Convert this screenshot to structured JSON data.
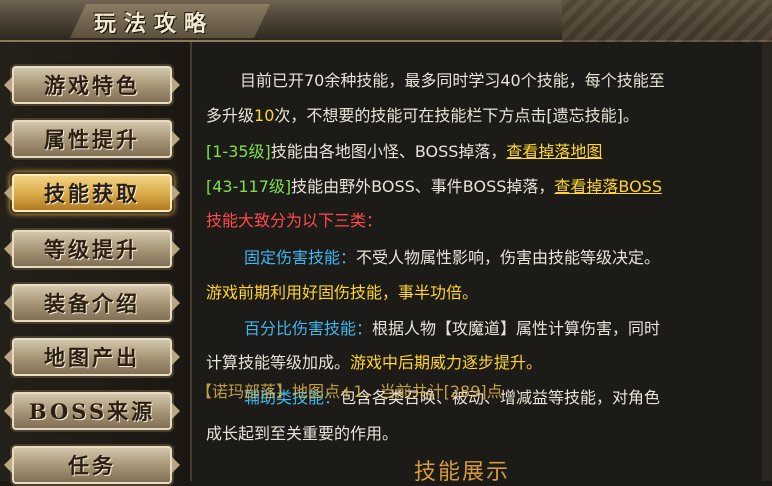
{
  "window": {
    "title": "玩法攻略"
  },
  "sidebar": {
    "items": [
      {
        "label": "游戏特色",
        "active": false
      },
      {
        "label": "属性提升",
        "active": false
      },
      {
        "label": "技能获取",
        "active": true
      },
      {
        "label": "等级提升",
        "active": false
      },
      {
        "label": "装备介绍",
        "active": false
      },
      {
        "label": "地图产出",
        "active": false
      },
      {
        "label": "BOSS来源",
        "active": false
      },
      {
        "label": "任务",
        "active": false
      }
    ]
  },
  "content": {
    "intro_line1": "目前已开70余种技能，最多同时学习40个技能，每个技能至",
    "intro_line2_a": "多升级",
    "intro_line2_num": "10",
    "intro_line2_b": "次，不想要的技能可在技能栏下方点击[遗忘技能]。",
    "range1_tag": "[1-35级]",
    "range1_text": "技能由各地图小怪、BOSS掉落，",
    "range1_link": "查看掉落地图",
    "range2_tag": "[43-117级]",
    "range2_text": "技能由野外BOSS、事件BOSS掉落，",
    "range2_link": "查看掉落BOSS",
    "categories_heading": "技能大致分为以下三类：",
    "fixed_label": "固定伤害技能：",
    "fixed_text": "不受人物属性影响，伤害由技能等级决定。",
    "fixed_tip": "游戏前期利用好固伤技能，事半功倍。",
    "percent_label": "百分比伤害技能：",
    "percent_text1": "根据人物【攻魔道】属性计算伤害，同时",
    "percent_text2": "计算技能等级加成。",
    "percent_tip": "游戏中后期威力逐步提升。",
    "aux_label": "辅助类技能：",
    "aux_text1": "包含各类召唤、被动、增减益等技能，对角色",
    "aux_text2": "成长起到至关重要的作用。",
    "overlay_text": "【诺玛部落】地图点+1，当前共计[289]点",
    "section_title": "技能展示"
  },
  "colors": {
    "accent_gold": "#ffd52e",
    "accent_green": "#7de04a",
    "accent_red": "#ff4b4b",
    "accent_blue": "#3fb6f0"
  }
}
